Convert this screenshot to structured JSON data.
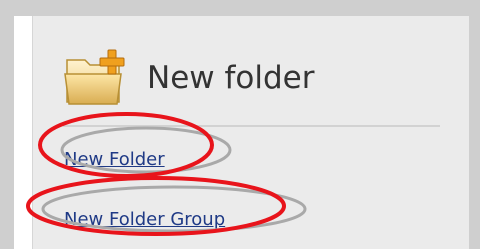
{
  "panel": {
    "title": "New folder",
    "icon": "folder-add-icon"
  },
  "links": {
    "new_folder": "New Folder",
    "new_folder_group": "New Folder Group"
  },
  "colors": {
    "frame": "#cfcfcf",
    "panel_bg": "#ebebeb",
    "link": "#1f3a86",
    "annotation_red": "#e8141b",
    "annotation_gray": "#a9a9a9"
  }
}
